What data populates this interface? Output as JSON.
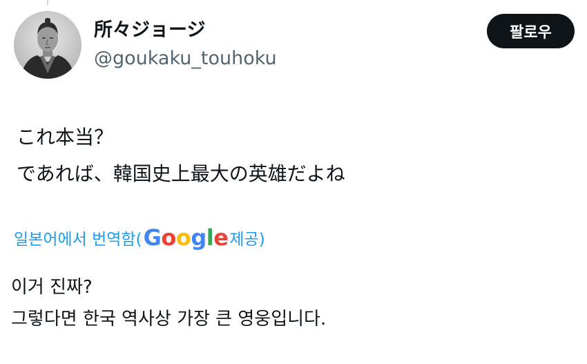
{
  "author": {
    "display_name": "所々ジョージ",
    "handle": "@goukaku_touhoku"
  },
  "follow_button": {
    "label": "팔로우"
  },
  "tweet": {
    "lines": [
      "これ本当？",
      "であれば、韓国史上最大の英雄だよね"
    ]
  },
  "translation": {
    "prefix": "일본어에서 번역함(",
    "provider_letters": [
      "G",
      "o",
      "o",
      "g",
      "l",
      "e"
    ],
    "suffix": " 제공)",
    "lines": [
      "이거 진짜?",
      "그렇다면 한국 역사상 가장 큰 영웅입니다."
    ]
  },
  "colors": {
    "link": "#1d9bf0",
    "secondary_text": "#536471",
    "follow_button_bg": "#0f1419"
  }
}
